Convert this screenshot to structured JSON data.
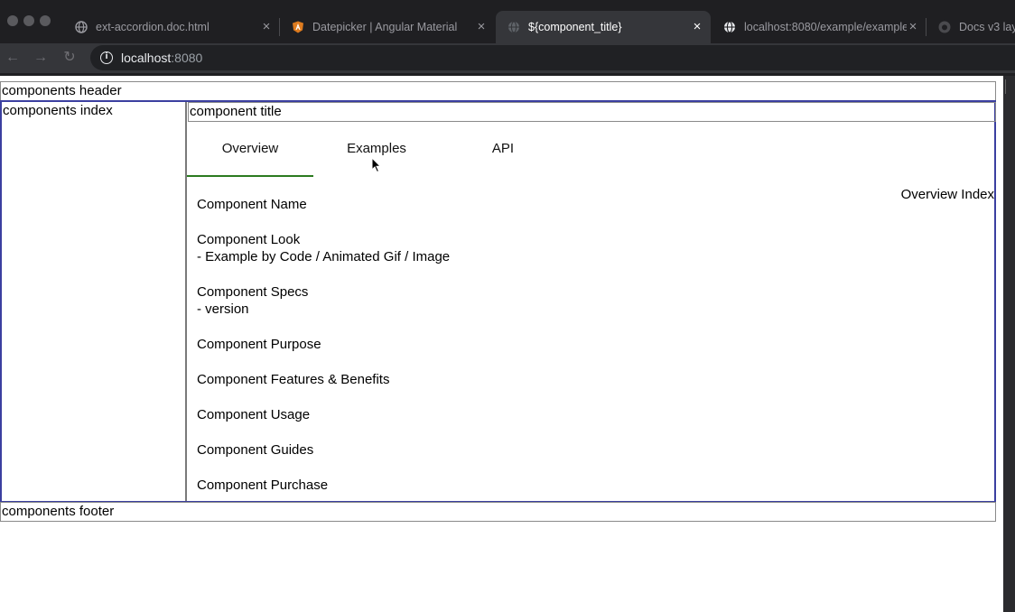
{
  "browser": {
    "tabs": [
      {
        "title": "ext-accordion.doc.html",
        "icon": "globe-icon"
      },
      {
        "title": "Datepicker | Angular Material",
        "icon": "angular-shield-icon"
      },
      {
        "title": "${component_title}",
        "icon": "globe-icon",
        "active": true
      },
      {
        "title": "localhost:8080/example/example",
        "icon": "globe-icon"
      },
      {
        "title": "Docs v3 lay",
        "icon": "github-icon"
      }
    ],
    "close_glyph": "×",
    "url_host": "localhost",
    "url_port": ":8080"
  },
  "page": {
    "header": "components header",
    "index": "components index",
    "title": "component title",
    "tabs": [
      "Overview",
      "Examples",
      "API"
    ],
    "overview_index": "Overview Index",
    "sections": [
      {
        "heading": "Component Name",
        "sub": ""
      },
      {
        "heading": "Component Look",
        "sub": "- Example by Code / Animated Gif / Image"
      },
      {
        "heading": "Component Specs",
        "sub": "- version"
      },
      {
        "heading": "Component Purpose",
        "sub": ""
      },
      {
        "heading": "Component Features & Benefits",
        "sub": ""
      },
      {
        "heading": "Component Usage",
        "sub": ""
      },
      {
        "heading": "Component Guides",
        "sub": ""
      },
      {
        "heading": "Component Purchase",
        "sub": ""
      }
    ],
    "footer": "components footer"
  },
  "colors": {
    "chrome_dark": "#1f1f22",
    "tab_active": "#35363a",
    "main_border": "#3b3fa0",
    "active_tab_underline": "#2b7a1f"
  }
}
